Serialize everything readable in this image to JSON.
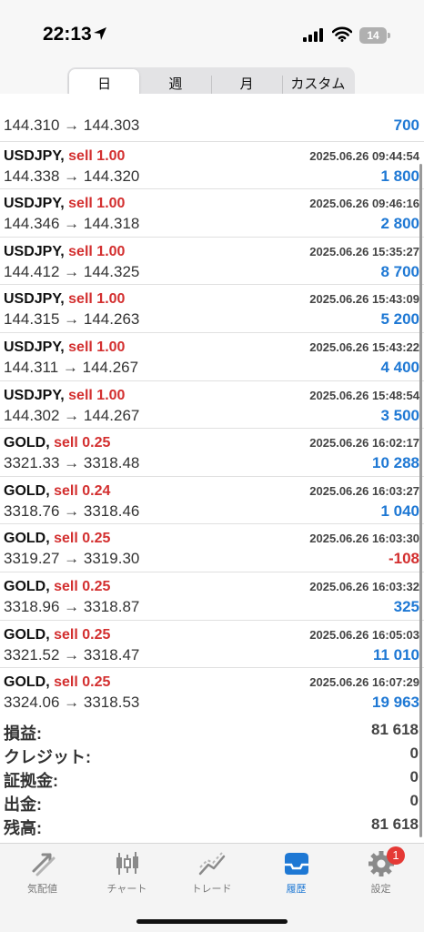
{
  "status_bar": {
    "time": "22:13",
    "battery": "14"
  },
  "period_tabs": [
    "日",
    "週",
    "月",
    "カスタム"
  ],
  "partial_row": {
    "prices": "144.310 → 144.303",
    "profit": "700"
  },
  "trades": [
    {
      "symbol": "USDJPY,",
      "side": "sell 1.00",
      "datetime": "2025.06.26 09:44:54",
      "prices": "144.338 → 144.320",
      "profit": "1 800",
      "negative": false
    },
    {
      "symbol": "USDJPY,",
      "side": "sell 1.00",
      "datetime": "2025.06.26 09:46:16",
      "prices": "144.346 → 144.318",
      "profit": "2 800",
      "negative": false
    },
    {
      "symbol": "USDJPY,",
      "side": "sell 1.00",
      "datetime": "2025.06.26 15:35:27",
      "prices": "144.412 → 144.325",
      "profit": "8 700",
      "negative": false
    },
    {
      "symbol": "USDJPY,",
      "side": "sell 1.00",
      "datetime": "2025.06.26 15:43:09",
      "prices": "144.315 → 144.263",
      "profit": "5 200",
      "negative": false
    },
    {
      "symbol": "USDJPY,",
      "side": "sell 1.00",
      "datetime": "2025.06.26 15:43:22",
      "prices": "144.311 → 144.267",
      "profit": "4 400",
      "negative": false
    },
    {
      "symbol": "USDJPY,",
      "side": "sell 1.00",
      "datetime": "2025.06.26 15:48:54",
      "prices": "144.302 → 144.267",
      "profit": "3 500",
      "negative": false
    },
    {
      "symbol": "GOLD,",
      "side": "sell 0.25",
      "datetime": "2025.06.26 16:02:17",
      "prices": "3321.33 → 3318.48",
      "profit": "10 288",
      "negative": false
    },
    {
      "symbol": "GOLD,",
      "side": "sell 0.24",
      "datetime": "2025.06.26 16:03:27",
      "prices": "3318.76 → 3318.46",
      "profit": "1 040",
      "negative": false
    },
    {
      "symbol": "GOLD,",
      "side": "sell 0.25",
      "datetime": "2025.06.26 16:03:30",
      "prices": "3319.27 → 3319.30",
      "profit": "-108",
      "negative": true
    },
    {
      "symbol": "GOLD,",
      "side": "sell 0.25",
      "datetime": "2025.06.26 16:03:32",
      "prices": "3318.96 → 3318.87",
      "profit": "325",
      "negative": false
    },
    {
      "symbol": "GOLD,",
      "side": "sell 0.25",
      "datetime": "2025.06.26 16:05:03",
      "prices": "3321.52 → 3318.47",
      "profit": "11 010",
      "negative": false
    },
    {
      "symbol": "GOLD,",
      "side": "sell 0.25",
      "datetime": "2025.06.26 16:07:29",
      "prices": "3324.06 → 3318.53",
      "profit": "19 963",
      "negative": false
    }
  ],
  "summary": [
    {
      "label": "損益:",
      "value": "81 618"
    },
    {
      "label": "クレジット:",
      "value": "0"
    },
    {
      "label": "証拠金:",
      "value": "0"
    },
    {
      "label": "出金:",
      "value": "0"
    },
    {
      "label": "残高:",
      "value": "81 618"
    }
  ],
  "tabbar": {
    "items": [
      "気配値",
      "チャート",
      "トレード",
      "履歴",
      "設定"
    ],
    "badge": "1",
    "active_color": "#1e78d4"
  },
  "colors": {
    "profit": "#1e78d4",
    "loss": "#d32f2f",
    "sell": "#d32f2f"
  }
}
